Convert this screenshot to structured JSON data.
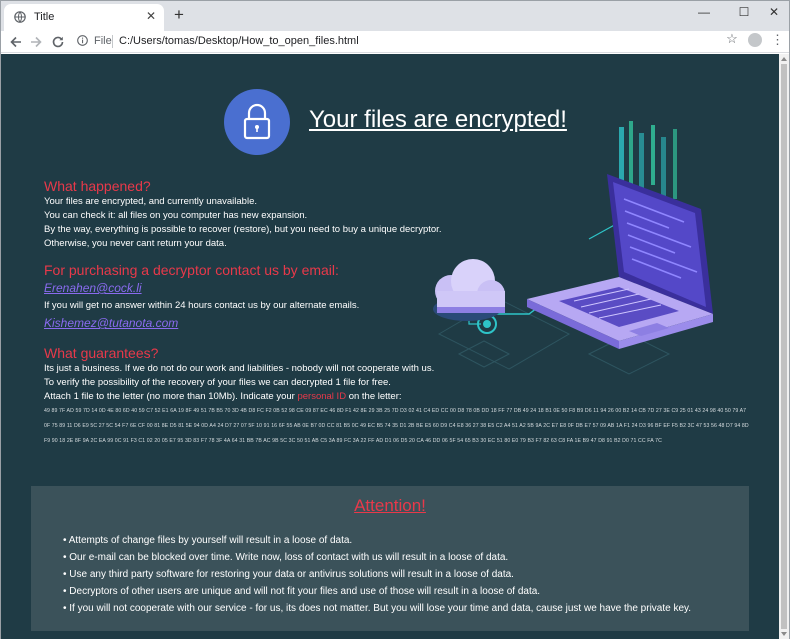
{
  "browser": {
    "tab_title": "Title",
    "new_tab": "+",
    "file_label": "File",
    "url": "C:/Users/tomas/Desktop/How_to_open_files.html",
    "controls": {
      "minimize": "—",
      "maximize": "☐",
      "close": "✕"
    }
  },
  "page": {
    "headline": "Your files are encrypted!",
    "what_happened": {
      "title": "What happened?",
      "lines": [
        "Your files are encrypted, and currently unavailable.",
        "You can check it: all files on you computer has new expansion.",
        "By the way, everything is possible to recover (restore), but you need to buy a unique decryptor.",
        "Otherwise, you never cant return your data."
      ]
    },
    "purchase": {
      "title": "For purchasing a decryptor contact us by email:",
      "email1": "Erenahen@cock.li",
      "note": "If you will get no answer within 24 hours contact us by our alternate emails.",
      "email2": "Kishemez@tutanota.com"
    },
    "guarantees": {
      "title": "What guarantees?",
      "lines": [
        "Its just a business. If we do not do our work and liabilities - nobody will not cooperate with us.",
        "To verify the possibility of the recovery of your files we can decrypted 1 file for free."
      ],
      "attach_before": "Attach 1 file to the letter (no more than 10Mb). Indicate your ",
      "personal_id_label": "personal ID",
      "attach_after": " on the letter:",
      "hex_lines": [
        "49 89 7F AD 59 7D 14 0D 4E 80 6D 40 59 C7 52 E1 6A 19 8F 49 51 7B B5 70 3D 4B D8 FC F2 0B 52 98 CE 09 87 EC 46 8D F1 42 8E 29 3B 25 7D D3 02 41 C4 ED CC 00 D8 78 0B DD 18 FF 77 DB 49 24 18 B1 0E 50 F8 B9 D6 11 94 26 00 B2 14 CB 7D 27 3E C9 25 01 43 24 98 40 50 79 A7",
        "0F 75 89 11 D6 E9 5C 27 5C 54 F7 6E CF 00 81 8E D5 81 5E 94 0D A4 24 D7 27 07 5F 10 91 16 6F 55 AB 0E B7 0D CC 81 B5 0C 49 EC B5 74 35 D1 2B BE E5 60 D9 C4 E8 36 27 38 E5 C2 A4 51 A2 5B 9A 2C E7 E8 0F DB E7 57 09 AB 1A F1 24 D3 96 BF EF F5 B2 3C 47 53 56 48 D7 94 8D",
        "F9 90 18 2E 8F 9A 2C EA 99 0C 91 F3 C1 02 20 05 E7 95 3D 83 F7 78 3F 4A 64 31 BB 7B AC 9B 5C 3C 50 51 AB C5 3A 89 FC 3A 22 FF AD D1 06 D5 20 CA 46 DD 06 5F 54 65 B3 30 EC 51 80 E0 79 B3 F7 82 63 C8 FA 1E B9 47 D8 91 B2 D0 71 CC FA 7C"
      ]
    },
    "attention": {
      "title": "Attention!",
      "bullets": [
        "• Attempts of change files by yourself will result in a loose of data.",
        "• Our e-mail can be blocked over time. Write now, loss of contact with us will result in a loose of data.",
        "• Use any third party software for restoring your data or antivirus solutions will result in a loose of data.",
        "• Decryptors of other users are unique and will not fit your files and use of those will result in a loose of data.",
        "• If you will not cooperate with our service - for us, its does not matter. But you will lose your time and data, cause just we have the private key."
      ]
    }
  },
  "colors": {
    "page_bg": "#1f3b45",
    "heading_red": "#e8394a",
    "email_purple": "#8a6bf0",
    "lock_blue": "#4a6fd0",
    "attention_bg": "#3b525a"
  },
  "icons": {
    "favicon": "globe-icon",
    "back": "back-arrow-icon",
    "forward": "forward-arrow-icon",
    "reload": "reload-icon",
    "info": "info-icon",
    "bookmark": "star-icon",
    "profile": "avatar-icon",
    "menu": "kebab-menu-icon",
    "headline_icon": "padlock-icon",
    "illustration": "laptop-cloud-illustration"
  }
}
